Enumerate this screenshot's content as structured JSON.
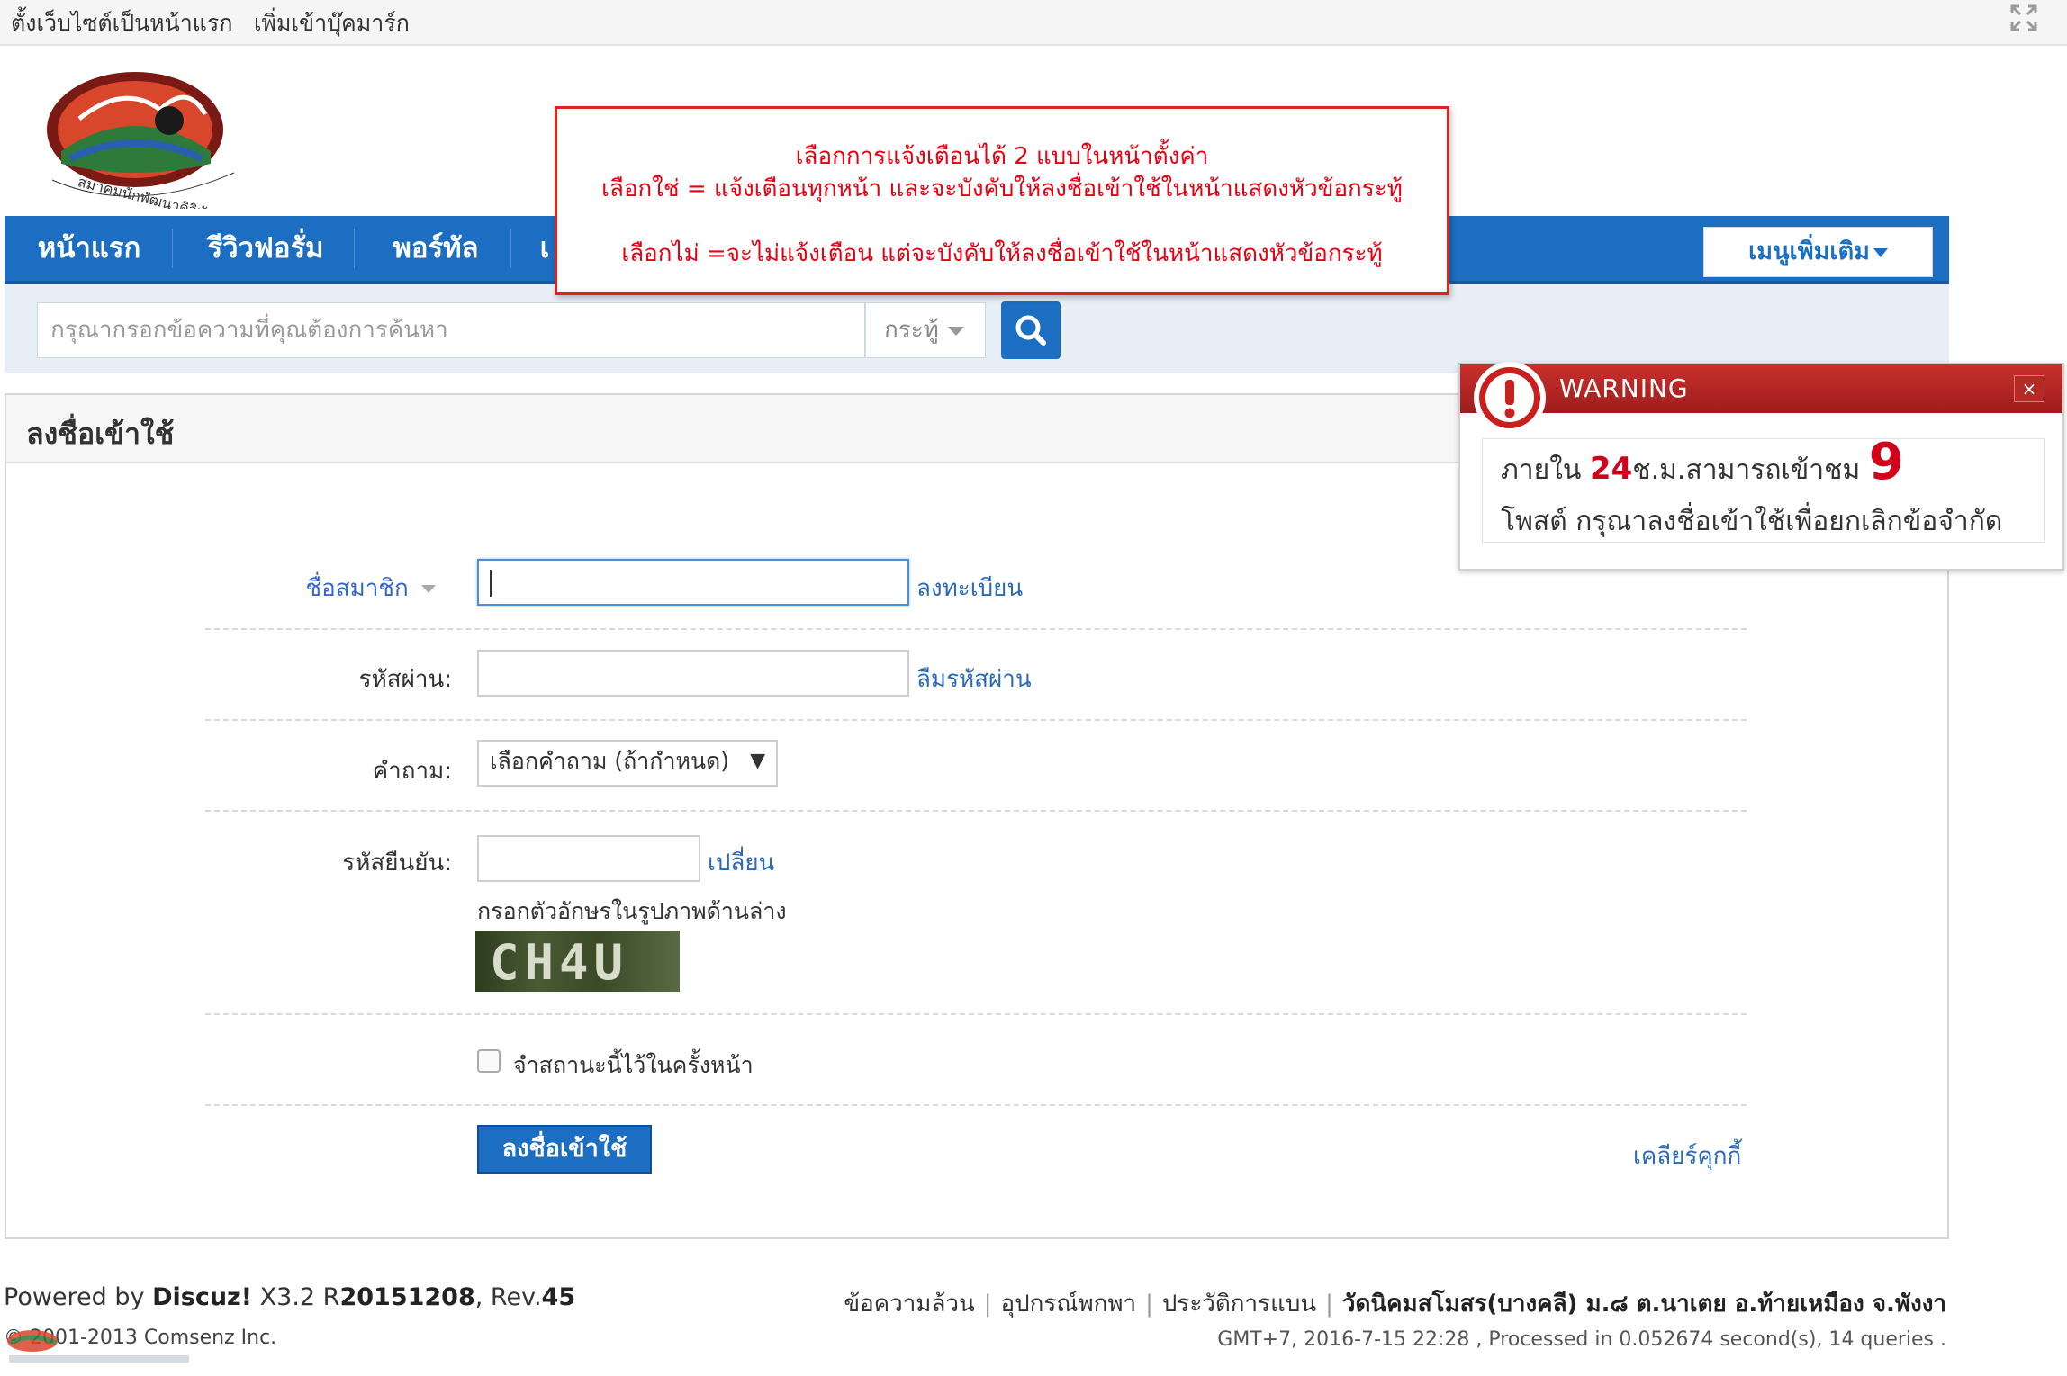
{
  "topbar": {
    "set_home": "ตั้งเว็บไซต์เป็นหน้าแรก",
    "add_bookmark": "เพิ่มเข้าบุ๊คมาร์ก"
  },
  "logo": {
    "text": "สมาคมนักพัฒนาดิจิทัลธรรมชาติพังงา"
  },
  "nav": {
    "items": [
      {
        "label": "หน้าแรก"
      },
      {
        "label": "รีวิวฟอรั่ม"
      },
      {
        "label": "พอร์ทัล"
      },
      {
        "label": "เ"
      }
    ],
    "more_menu": "เมนูเพิ่มเติม"
  },
  "search": {
    "placeholder": "กรุณากรอกข้อความที่คุณต้องการค้นหา",
    "type": "กระทู้"
  },
  "annotation": {
    "line1": "เลือกการแจ้งเตือนได้ 2 แบบในหน้าตั้งค่า",
    "line2": "เลือกใช่ = แจ้งเตือนทุกหน้า และจะบังคับให้ลงชื่อเข้าใช้ในหน้าแสดงหัวข้อกระทู้",
    "line3": "เลือกไม่ =จะไม่แจ้งเตือน แต่จะบังคับให้ลงชื่อเข้าใช้ในหน้าแสดงหัวข้อกระทู้"
  },
  "login": {
    "title": "ลงชื่อเข้าใช้",
    "username_label": "ชื่อสมาชิก",
    "register_link": "ลงทะเบียน",
    "password_label": "รหัสผ่าน:",
    "forgot_link": "ลืมรหัสผ่าน",
    "question_label": "คำถาม:",
    "question_value": "เลือกคำถาม (ถ้ากำหนด)",
    "captcha_label": "รหัสยืนยัน:",
    "captcha_change": "เปลี่ยน",
    "captcha_hint": "กรอกตัวอักษรในรูปภาพด้านล่าง",
    "captcha_text": "CH4U",
    "remember_label": "จำสถานะนี้ไว้ในครั้งหน้า",
    "submit": "ลงชื่อเข้าใช้",
    "clear_cookie": "เคลียร์คุกกี้"
  },
  "warning": {
    "title": "WARNING",
    "close": "×",
    "line1_pre": "ภายใน ",
    "hours": "24",
    "line1_mid": "ช.ม.สามารถเข้าชม ",
    "count": "9",
    "line2": "โพสต์ กรุณาลงชื่อเข้าใช้เพื่อยกเลิกข้อจำกัด"
  },
  "footer": {
    "powered_pre": "Powered by ",
    "product": "Discuz!",
    "version_pre": " X3.2 R",
    "build": "20151208",
    "rev_pre": ", Rev.",
    "rev": "45",
    "links": [
      "ข้อความล้วน",
      "อุปกรณ์พกพา",
      "ประวัติการแบน"
    ],
    "site": "วัดนิคมสโมสร(บางคลี) ม.๘ ต.นาเตย อ.ท้ายเหมือง จ.พังงา",
    "copyright": "© 2001-2013 Comsenz Inc.",
    "stats": "GMT+7, 2016-7-15 22:28 , Processed in 0.052674 second(s), 14 queries ."
  },
  "colors": {
    "nav_blue": "#1c6ec2",
    "warning_red": "#c9302c",
    "annotation_red": "#e60012",
    "link_blue": "#2a6ab8"
  }
}
